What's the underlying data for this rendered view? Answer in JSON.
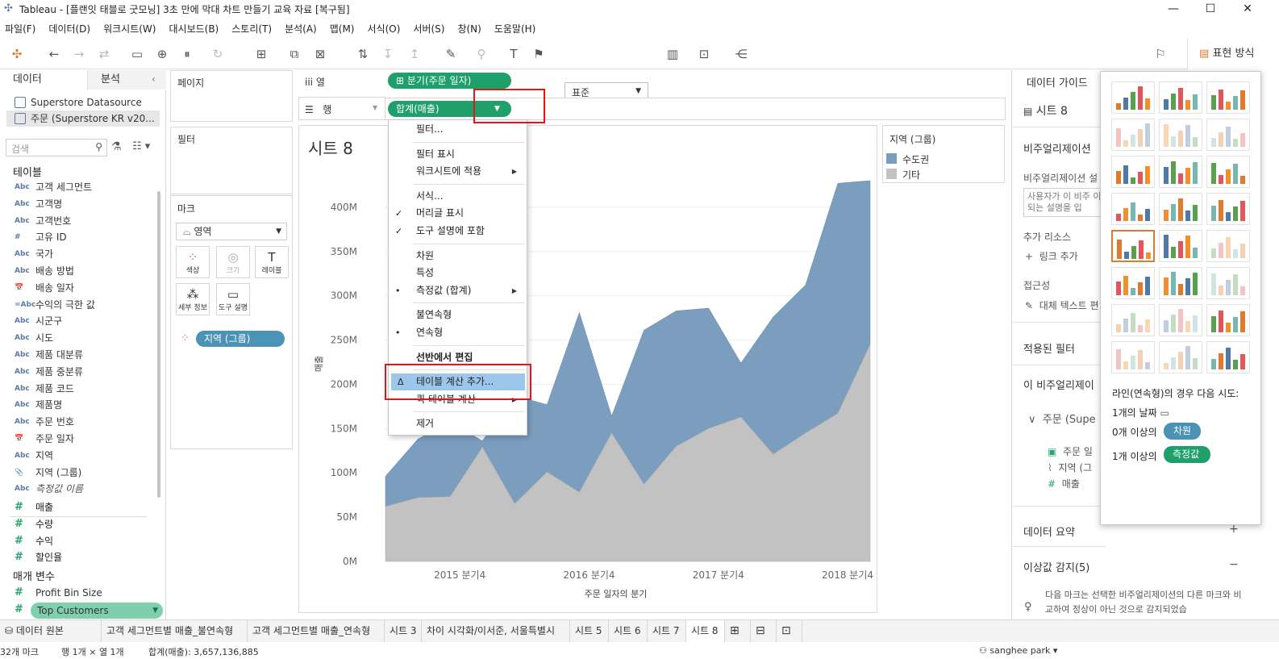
{
  "window": {
    "title": "Tableau - [플랜잇 태블로 굿모닝] 3초 만에 막대 차트 만들기 교육 자료 [복구됨]",
    "minimize": "—",
    "maximize": "☐",
    "close": "✕"
  },
  "menu": [
    "파일(F)",
    "데이터(D)",
    "워크시트(W)",
    "대시보드(B)",
    "스토리(T)",
    "분석(A)",
    "맵(M)",
    "서식(O)",
    "서버(S)",
    "창(N)",
    "도움말(H)"
  ],
  "toolbar": {
    "format_select": "표준",
    "show_me_label": "표현 방식"
  },
  "data_pane": {
    "tab_data": "데이터",
    "tab_analysis": "분석",
    "datasources": [
      "Superstore Datasource",
      "주문 (Superstore KR v20..."
    ],
    "search_placeholder": "검색",
    "tables_header": "테이블",
    "dimensions": [
      {
        "icon": "Abc",
        "name": "고객 세그먼트"
      },
      {
        "icon": "Abc",
        "name": "고객명"
      },
      {
        "icon": "Abc",
        "name": "고객번호"
      },
      {
        "icon": "#",
        "name": "고유 ID"
      },
      {
        "icon": "Abc",
        "name": "국가"
      },
      {
        "icon": "Abc",
        "name": "배송 방법"
      },
      {
        "icon": "📅",
        "name": "배송 일자"
      },
      {
        "icon": "=Abc",
        "name": "수익의 극한 값"
      },
      {
        "icon": "Abc",
        "name": "시군구"
      },
      {
        "icon": "Abc",
        "name": "시도"
      },
      {
        "icon": "Abc",
        "name": "제품 대분류"
      },
      {
        "icon": "Abc",
        "name": "제품 중분류"
      },
      {
        "icon": "Abc",
        "name": "제품 코드"
      },
      {
        "icon": "Abc",
        "name": "제품명"
      },
      {
        "icon": "Abc",
        "name": "주문 번호"
      },
      {
        "icon": "📅",
        "name": "주문 일자"
      },
      {
        "icon": "Abc",
        "name": "지역"
      },
      {
        "icon": "📎",
        "name": "지역 (그룹)"
      },
      {
        "icon": "Abc",
        "name": "측정값 이름"
      }
    ],
    "measures": [
      {
        "icon": "#",
        "name": "매출"
      },
      {
        "icon": "#",
        "name": "수량"
      },
      {
        "icon": "#",
        "name": "수익"
      },
      {
        "icon": "#",
        "name": "할인율"
      }
    ],
    "params_header": "매개 변수",
    "params": [
      "Profit Bin Size",
      "Top Customers"
    ]
  },
  "cards": {
    "pages": "페이지",
    "filters": "필터",
    "marks": "마크",
    "mark_type": "영역",
    "mark_buttons": [
      "색상",
      "크기",
      "레이블",
      "세부 정보",
      "도구 설명"
    ],
    "color_pill": "지역 (그룹)"
  },
  "shelves": {
    "columns_label": "열",
    "rows_label": "행",
    "column_pill": "분기(주문 일자)",
    "row_pill": "합계(매출)"
  },
  "sheet_title": "시트 8",
  "legend": {
    "title": "지역 (그룹)",
    "items": [
      {
        "label": "수도권",
        "color": "#7b9ebf"
      },
      {
        "label": "기타",
        "color": "#c2c2c2"
      }
    ]
  },
  "context_menu": [
    {
      "label": "필터...",
      "check": "",
      "sub": false
    },
    {
      "sep": true
    },
    {
      "label": "필터 표시",
      "check": "",
      "sub": false
    },
    {
      "label": "워크시트에 적용",
      "check": "",
      "sub": true
    },
    {
      "sep": true
    },
    {
      "label": "서식...",
      "check": "",
      "sub": false
    },
    {
      "label": "머리글 표시",
      "check": "✓",
      "sub": false
    },
    {
      "label": "도구 설명에 포함",
      "check": "✓",
      "sub": false
    },
    {
      "sep": true
    },
    {
      "label": "차원",
      "check": "",
      "sub": false
    },
    {
      "label": "특성",
      "check": "",
      "sub": false
    },
    {
      "label": "측정값 (합계)",
      "check": "•",
      "sub": true
    },
    {
      "sep": true
    },
    {
      "label": "불연속형",
      "check": "",
      "sub": false
    },
    {
      "label": "연속형",
      "check": "•",
      "sub": false
    },
    {
      "sep": true
    },
    {
      "label": "선반에서 편집",
      "check": "",
      "sub": false,
      "bold": true
    },
    {
      "sep": true
    },
    {
      "label": "테이블 계산 추가...",
      "check": "Δ",
      "sub": false,
      "highlight": true
    },
    {
      "label": "퀵 테이블 계산",
      "check": "",
      "sub": true
    },
    {
      "sep": true
    },
    {
      "label": "제거",
      "check": "",
      "sub": false
    }
  ],
  "data_guide": {
    "title": "데이터 가이드",
    "sheet": "시트 8",
    "viz_desc_header": "비주얼리제이션",
    "viz_desc_label": "비주얼리제이션 설",
    "viz_desc_placeholder": "사용자가 이 비주 이 되는 설명을 입",
    "resources_header": "추가 리소스",
    "add_link": "링크 추가",
    "access_header": "접근성",
    "alt_text": "대체 텍스트 편",
    "applied_filters": "적용된 필터",
    "this_viz": "이 비주얼리제이",
    "source": "주문 (Supe",
    "fields": [
      "주문 일",
      "지역 (그",
      "매출"
    ],
    "summary": "데이터 요약",
    "outliers": "이상값 감지(5)",
    "outlier_text": "다음 마크는 선택한 비주얼리제이션의 다른 마크와 비교하여 정상이 아닌 것으로 감지되었습"
  },
  "show_me": {
    "hint_title": "라인(연속형)의 경우 다음 시도:",
    "hint_dates": "1개의 날짜",
    "hint_dims_prefix": "0개 이상의",
    "hint_dims_pill": "차원",
    "hint_measures_prefix": "1개 이상의",
    "hint_measures_pill": "측정값"
  },
  "tabs": [
    "데이터 원본",
    "고객 세그먼트별 매출_불연속형",
    "고객 세그먼트별 매출_연속형",
    "시트 3",
    "차이 시각화/이서준, 서울특별시",
    "시트 5",
    "시트 6",
    "시트 7",
    "시트 8"
  ],
  "status": {
    "marks": "32개 마크",
    "rowcol": "행 1개 × 열 1개",
    "sum": "합계(매출): 3,657,136,885",
    "user": "sanghee park"
  },
  "chart_data": {
    "type": "area",
    "title": "시트 8",
    "xlabel": "주문 일자의 분기",
    "ylabel": "매출",
    "x_tick_labels": [
      "2015 분기4",
      "2016 분기4",
      "2017 분기4",
      "2018 분기4"
    ],
    "y_tick_labels": [
      "0M",
      "50M",
      "100M",
      "150M",
      "200M",
      "250M",
      "300M",
      "350M",
      "400M"
    ],
    "ylim": [
      0,
      430000000
    ],
    "stacked": true,
    "categories": [
      "2015 Q1",
      "2015 Q2",
      "2015 Q3",
      "2015 Q4",
      "2016 Q1",
      "2016 Q2",
      "2016 Q3",
      "2016 Q4",
      "2017 Q1",
      "2017 Q2",
      "2017 Q3",
      "2017 Q4",
      "2018 Q1",
      "2018 Q2",
      "2018 Q3",
      "2018 Q4"
    ],
    "series": [
      {
        "name": "기타",
        "color": "#c2c2c2",
        "values": [
          62000000,
          72000000,
          73000000,
          129000000,
          65000000,
          101000000,
          78000000,
          145000000,
          87000000,
          130000000,
          150000000,
          163000000,
          121000000,
          145000000,
          167000000,
          245000000
        ]
      },
      {
        "name": "수도권",
        "color": "#7b9ebf",
        "values": [
          34000000,
          66000000,
          85000000,
          7000000,
          122000000,
          76000000,
          203000000,
          19000000,
          174000000,
          153000000,
          136000000,
          61000000,
          155000000,
          167000000,
          260000000,
          185000000
        ]
      }
    ],
    "grid": true
  }
}
